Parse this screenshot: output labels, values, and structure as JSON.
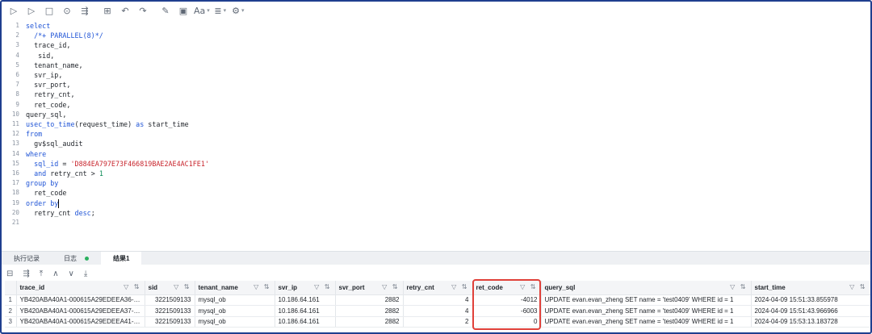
{
  "toolbar": {
    "icons": [
      "play-icon",
      "step-play-icon",
      "stop-icon",
      "history-icon",
      "format-icon",
      "save-icon",
      "undo-icon",
      "redo-icon",
      "wand-icon",
      "text-case-icon",
      "font-size-icon",
      "list-icon",
      "settings-icon"
    ],
    "font_label": "Aa",
    "glyphs": {
      "play": "▷",
      "step": "▷",
      "stop": "□",
      "history": "⊙",
      "format": "⇶",
      "save": "⊞",
      "undo": "↶",
      "redo": "↷",
      "wand": "✎",
      "box": "▣",
      "list": "≣",
      "gear": "⚙",
      "caret": "▾"
    }
  },
  "editor": {
    "lines": [
      {
        "n": "1",
        "html_key": "l1"
      },
      {
        "n": "2"
      },
      {
        "n": "3"
      },
      {
        "n": "4"
      },
      {
        "n": "5"
      },
      {
        "n": "6"
      },
      {
        "n": "7"
      },
      {
        "n": "8"
      },
      {
        "n": "9"
      },
      {
        "n": "10"
      },
      {
        "n": "11"
      },
      {
        "n": "12"
      },
      {
        "n": "13"
      },
      {
        "n": "14"
      },
      {
        "n": "15"
      },
      {
        "n": "16"
      },
      {
        "n": "17"
      },
      {
        "n": "18"
      },
      {
        "n": "19"
      },
      {
        "n": "20"
      },
      {
        "n": "21"
      }
    ],
    "tokens": {
      "select": "select",
      "hint": "/*+ PARALLEL(8)*/",
      "trace_id": "trace_id,",
      "sid": "sid,",
      "tenant_name": "tenant_name,",
      "svr_ip": "svr_ip,",
      "svr_port": "svr_port,",
      "retry_cnt": "retry_cnt,",
      "ret_code": "ret_code,",
      "query_sql": "query_sql,",
      "usec_fn": "usec_to_time",
      "usec_arg": "(request_time)",
      "as": "as",
      "start_time": "start_time",
      "from": "from",
      "table": "gv$sql_audit",
      "where": "where",
      "sql_id": "sql_id",
      "eq": "=",
      "sql_id_val": "'D884EA797E73F466819BAE2AE4AC1FE1'",
      "and": "and",
      "retry_cnt_kw": "retry_cnt",
      "gt": ">",
      "one": "1",
      "group": "group",
      "by": "by",
      "ret_code_g": "ret_code",
      "order": "order",
      "by2": "by",
      "retry_desc_col": "retry_cnt",
      "desc": "desc",
      "semicolon": ";"
    }
  },
  "tabs": [
    {
      "label": "执行记录"
    },
    {
      "label": "日志"
    },
    {
      "label": "结果1"
    }
  ],
  "result_toolbar": {
    "glyphs": [
      "⊟",
      "⇶",
      "⤒",
      "∧",
      "∨",
      "⤓"
    ]
  },
  "grid": {
    "columns": [
      "trace_id",
      "sid",
      "tenant_name",
      "svr_ip",
      "svr_port",
      "retry_cnt",
      "ret_code",
      "query_sql",
      "start_time"
    ],
    "header_icons": "▽ ⇅",
    "rows": [
      [
        "1",
        "YB420ABA40A1-000615A29EDEEA36-0...",
        "3221509133",
        "mysql_ob",
        "10.186.64.161",
        "2882",
        "4",
        "-4012",
        "UPDATE evan.evan_zheng SET name = 'test0409' WHERE id = 1",
        "2024-04-09 15:51:33.855978"
      ],
      [
        "2",
        "YB420ABA40A1-000615A29EDEEA37-0...",
        "3221509133",
        "mysql_ob",
        "10.186.64.161",
        "2882",
        "4",
        "-6003",
        "UPDATE evan.evan_zheng SET name = 'test0409' WHERE id = 1",
        "2024-04-09 15:51:43.966966"
      ],
      [
        "3",
        "YB420ABA40A1-000615A29EDEEA41-0...",
        "3221509133",
        "mysql_ob",
        "10.186.64.161",
        "2882",
        "2",
        "0",
        "UPDATE evan.evan_zheng SET name = 'test0409' WHERE id = 1",
        "2024-04-09 15:53:13.183728"
      ]
    ]
  },
  "colors": {
    "highlight": "#e0413a",
    "keyword": "#1f54d6",
    "string": "#c8252d",
    "number": "#0a8a55",
    "frame": "#1f3f8f"
  }
}
